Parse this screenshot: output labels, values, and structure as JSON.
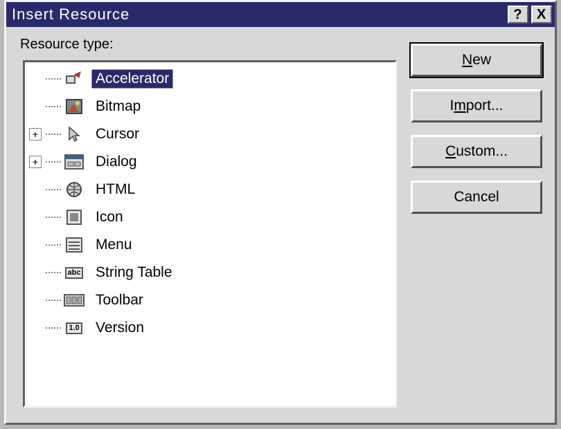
{
  "title": "Insert Resource",
  "help_label": "?",
  "close_label": "X",
  "label": "Resource type:",
  "tree": [
    {
      "icon": "accelerator-icon",
      "label": "Accelerator",
      "selected": true,
      "expandable": false
    },
    {
      "icon": "bitmap-icon",
      "label": "Bitmap",
      "selected": false,
      "expandable": false
    },
    {
      "icon": "cursor-icon",
      "label": "Cursor",
      "selected": false,
      "expandable": true
    },
    {
      "icon": "dialog-icon",
      "label": "Dialog",
      "selected": false,
      "expandable": true
    },
    {
      "icon": "html-icon",
      "label": "HTML",
      "selected": false,
      "expandable": false
    },
    {
      "icon": "icon-icon",
      "label": "Icon",
      "selected": false,
      "expandable": false
    },
    {
      "icon": "menu-icon",
      "label": "Menu",
      "selected": false,
      "expandable": false
    },
    {
      "icon": "stringtable-icon",
      "label": "String Table",
      "selected": false,
      "expandable": false
    },
    {
      "icon": "toolbar-icon",
      "label": "Toolbar",
      "selected": false,
      "expandable": false
    },
    {
      "icon": "version-icon",
      "label": "Version",
      "selected": false,
      "expandable": false
    }
  ],
  "buttons": {
    "new": {
      "pre": "",
      "u": "N",
      "post": "ew"
    },
    "import": {
      "pre": "I",
      "u": "m",
      "post": "port..."
    },
    "custom": {
      "pre": "",
      "u": "C",
      "post": "ustom..."
    },
    "cancel": {
      "pre": "Cancel",
      "u": "",
      "post": ""
    }
  },
  "expander_plus": "+",
  "icons_text": {
    "stringtable": "abc",
    "version": "1.0"
  }
}
